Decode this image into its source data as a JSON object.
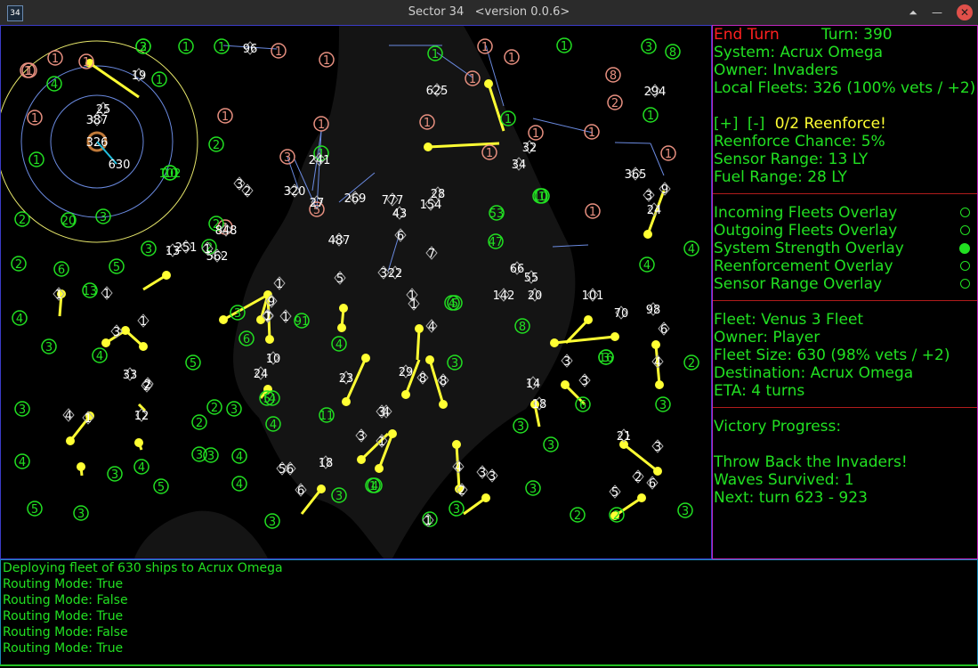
{
  "window": {
    "title": "Sector 34",
    "version": "<version 0.0.6>",
    "app_icon_text": "34"
  },
  "map": {
    "colors": {
      "player": "#22e022",
      "enemy": "#e89080",
      "neutral": "#ffffff",
      "fleet": "#ffff33",
      "lane": "#6a8ae0"
    },
    "rings": {
      "center_value": "326",
      "selected_label": "630"
    },
    "systems": [
      {
        "v": "2",
        "c": "g"
      },
      {
        "v": "1",
        "c": "g"
      },
      {
        "v": "1",
        "c": "g"
      },
      {
        "v": "1",
        "c": "e"
      },
      {
        "v": "1",
        "c": "e"
      },
      {
        "v": "1",
        "c": "e"
      },
      {
        "v": "1",
        "c": "e"
      },
      {
        "v": "1",
        "c": "g"
      },
      {
        "v": "3",
        "c": "g"
      },
      {
        "v": "8",
        "c": "g"
      },
      {
        "v": "8",
        "c": "e"
      },
      {
        "v": "2",
        "c": "e"
      },
      {
        "v": "1",
        "c": "e"
      },
      {
        "v": "1",
        "c": "e"
      },
      {
        "v": "1",
        "c": "e"
      },
      {
        "v": "1",
        "c": "g"
      },
      {
        "v": "1",
        "c": "e"
      },
      {
        "v": "1",
        "c": "e"
      },
      {
        "v": "1",
        "c": "g"
      },
      {
        "v": "5",
        "c": "e"
      },
      {
        "v": "3",
        "c": "e"
      },
      {
        "v": "1",
        "c": "e"
      },
      {
        "v": "1",
        "c": "g"
      },
      {
        "v": "1",
        "c": "g"
      },
      {
        "v": "1",
        "c": "e"
      },
      {
        "v": "1",
        "c": "e"
      },
      {
        "v": "1",
        "c": "g"
      },
      {
        "v": "4",
        "c": "g"
      },
      {
        "v": "2",
        "c": "g"
      },
      {
        "v": "1",
        "c": "g"
      },
      {
        "v": "1",
        "c": "e"
      },
      {
        "v": "1",
        "c": "e"
      },
      {
        "v": "1",
        "c": "e"
      },
      {
        "v": "1",
        "c": "e"
      },
      {
        "v": "1",
        "c": "e"
      },
      {
        "v": "1",
        "c": "e"
      },
      {
        "v": "1",
        "c": "g"
      },
      {
        "v": "2",
        "c": "g"
      },
      {
        "v": "3",
        "c": "g"
      },
      {
        "v": "2",
        "c": "g"
      },
      {
        "v": "10",
        "c": "g"
      },
      {
        "v": "1",
        "c": "e"
      },
      {
        "v": "6",
        "c": "g"
      },
      {
        "v": "4",
        "c": "g"
      },
      {
        "v": "3",
        "c": "g"
      },
      {
        "v": "5",
        "c": "g"
      },
      {
        "v": "4",
        "c": "g"
      },
      {
        "v": "91",
        "c": "g"
      },
      {
        "v": "4",
        "c": "g"
      },
      {
        "v": "8",
        "c": "g"
      },
      {
        "v": "5",
        "c": "g"
      },
      {
        "v": "3",
        "c": "g"
      },
      {
        "v": "6",
        "c": "g"
      },
      {
        "v": "4",
        "c": "g"
      },
      {
        "v": "5",
        "c": "g"
      },
      {
        "v": "2",
        "c": "g"
      },
      {
        "v": "4",
        "c": "g"
      },
      {
        "v": "3",
        "c": "g"
      },
      {
        "v": "2",
        "c": "g"
      },
      {
        "v": "3",
        "c": "g"
      },
      {
        "v": "11",
        "c": "g"
      },
      {
        "v": "4",
        "c": "g"
      },
      {
        "v": "3",
        "c": "g"
      },
      {
        "v": "4",
        "c": "g"
      },
      {
        "v": "4",
        "c": "g"
      },
      {
        "v": "4",
        "c": "g"
      },
      {
        "v": "3",
        "c": "g"
      },
      {
        "v": "1",
        "c": "g"
      },
      {
        "v": "5",
        "c": "g"
      },
      {
        "v": "5",
        "c": "g"
      },
      {
        "v": "3",
        "c": "g"
      },
      {
        "v": "3",
        "c": "g"
      },
      {
        "v": "3",
        "c": "g"
      },
      {
        "v": "4",
        "c": "g"
      },
      {
        "v": "3",
        "c": "g"
      },
      {
        "v": "4",
        "c": "g"
      },
      {
        "v": "3",
        "c": "g"
      },
      {
        "v": "1",
        "c": "g"
      },
      {
        "v": "2",
        "c": "g"
      },
      {
        "v": "2",
        "c": "g"
      },
      {
        "v": "3",
        "c": "g"
      },
      {
        "v": "3",
        "c": "g"
      },
      {
        "v": "3",
        "c": "g"
      },
      {
        "v": "3",
        "c": "g"
      },
      {
        "v": "2",
        "c": "g"
      },
      {
        "v": "3",
        "c": "g"
      },
      {
        "v": "13",
        "c": "g"
      },
      {
        "v": "102",
        "c": "g"
      },
      {
        "v": "20",
        "c": "g"
      },
      {
        "v": "3",
        "c": "g"
      },
      {
        "v": "2",
        "c": "g"
      },
      {
        "v": "4",
        "c": "g"
      },
      {
        "v": "2",
        "c": "g"
      },
      {
        "v": "53",
        "c": "g"
      },
      {
        "v": "47",
        "c": "g"
      },
      {
        "v": "10",
        "c": "g"
      },
      {
        "v": "5",
        "c": "g"
      },
      {
        "v": "4",
        "c": "g"
      },
      {
        "v": "3",
        "c": "g"
      },
      {
        "v": "16",
        "c": "g"
      },
      {
        "v": "3",
        "c": "g"
      },
      {
        "v": "6",
        "c": "g"
      },
      {
        "v": "3",
        "c": "g"
      }
    ],
    "labels": [
      "96",
      "19",
      "625",
      "294",
      "387",
      "25",
      "320",
      "3",
      "2",
      "241",
      "27",
      "269",
      "777",
      "43",
      "28",
      "154",
      "32",
      "34",
      "365",
      "9",
      "3",
      "24",
      "13",
      "848",
      "251",
      "562",
      "487",
      "6",
      "3",
      "22",
      "66",
      "55",
      "142",
      "20",
      "101",
      "70",
      "98",
      "6",
      "4",
      "8",
      "2",
      "24",
      "10",
      "23",
      "2",
      "33",
      "3",
      "4",
      "29",
      "8",
      "3",
      "3",
      "14",
      "18",
      "21",
      "3",
      "12",
      "1",
      "4",
      "18",
      "6",
      "3",
      "5",
      "2",
      "6",
      "2",
      "4",
      "3",
      "3",
      "1",
      "1",
      "4",
      "3",
      "6",
      "5",
      "1",
      "1",
      "1",
      "1",
      "9",
      "1",
      "7",
      "1",
      "1",
      "5",
      "1",
      "1",
      "7"
    ],
    "fleet_dots_count": 44,
    "labels_shown": 88
  },
  "panel": {
    "end_turn": "End Turn",
    "turn": "Turn: 390",
    "system": "System: Acrux Omega",
    "owner": "Owner: Invaders",
    "local_fleets": "Local Fleets: 326 (100% vets / +2)",
    "reenforce_plus": "[+]",
    "reenforce_minus": "[-]",
    "reenforce_text": "0/2 Reenforce!",
    "reenforce_chance": "Reenforce Chance: 5%",
    "sensor_range": "Sensor Range: 13 LY",
    "fuel_range": "Fuel Range: 28 LY",
    "overlays": [
      {
        "label": "Incoming Fleets Overlay",
        "on": false
      },
      {
        "label": "Outgoing Fleets Overlay",
        "on": false
      },
      {
        "label": "System Strength Overlay",
        "on": true
      },
      {
        "label": "Reenforcement Overlay",
        "on": false
      },
      {
        "label": "Sensor Range Overlay",
        "on": false
      }
    ],
    "fleet_name": "Fleet: Venus 3 Fleet",
    "fleet_owner": "Owner: Player",
    "fleet_size": "Fleet Size: 630 (98% vets / +2)",
    "destination": "Destination: Acrux Omega",
    "eta": "ETA: 4 turns",
    "victory_title": "Victory Progress:",
    "victory_goal": "Throw Back the Invaders!",
    "waves": "Waves Survived: 1",
    "next_wave": "Next: turn 623 - 923"
  },
  "log": [
    "Deploying fleet of 630 ships to Acrux Omega",
    "Routing Mode: True",
    "Routing Mode: False",
    "Routing Mode: True",
    "Routing Mode: False",
    "Routing Mode: True"
  ]
}
